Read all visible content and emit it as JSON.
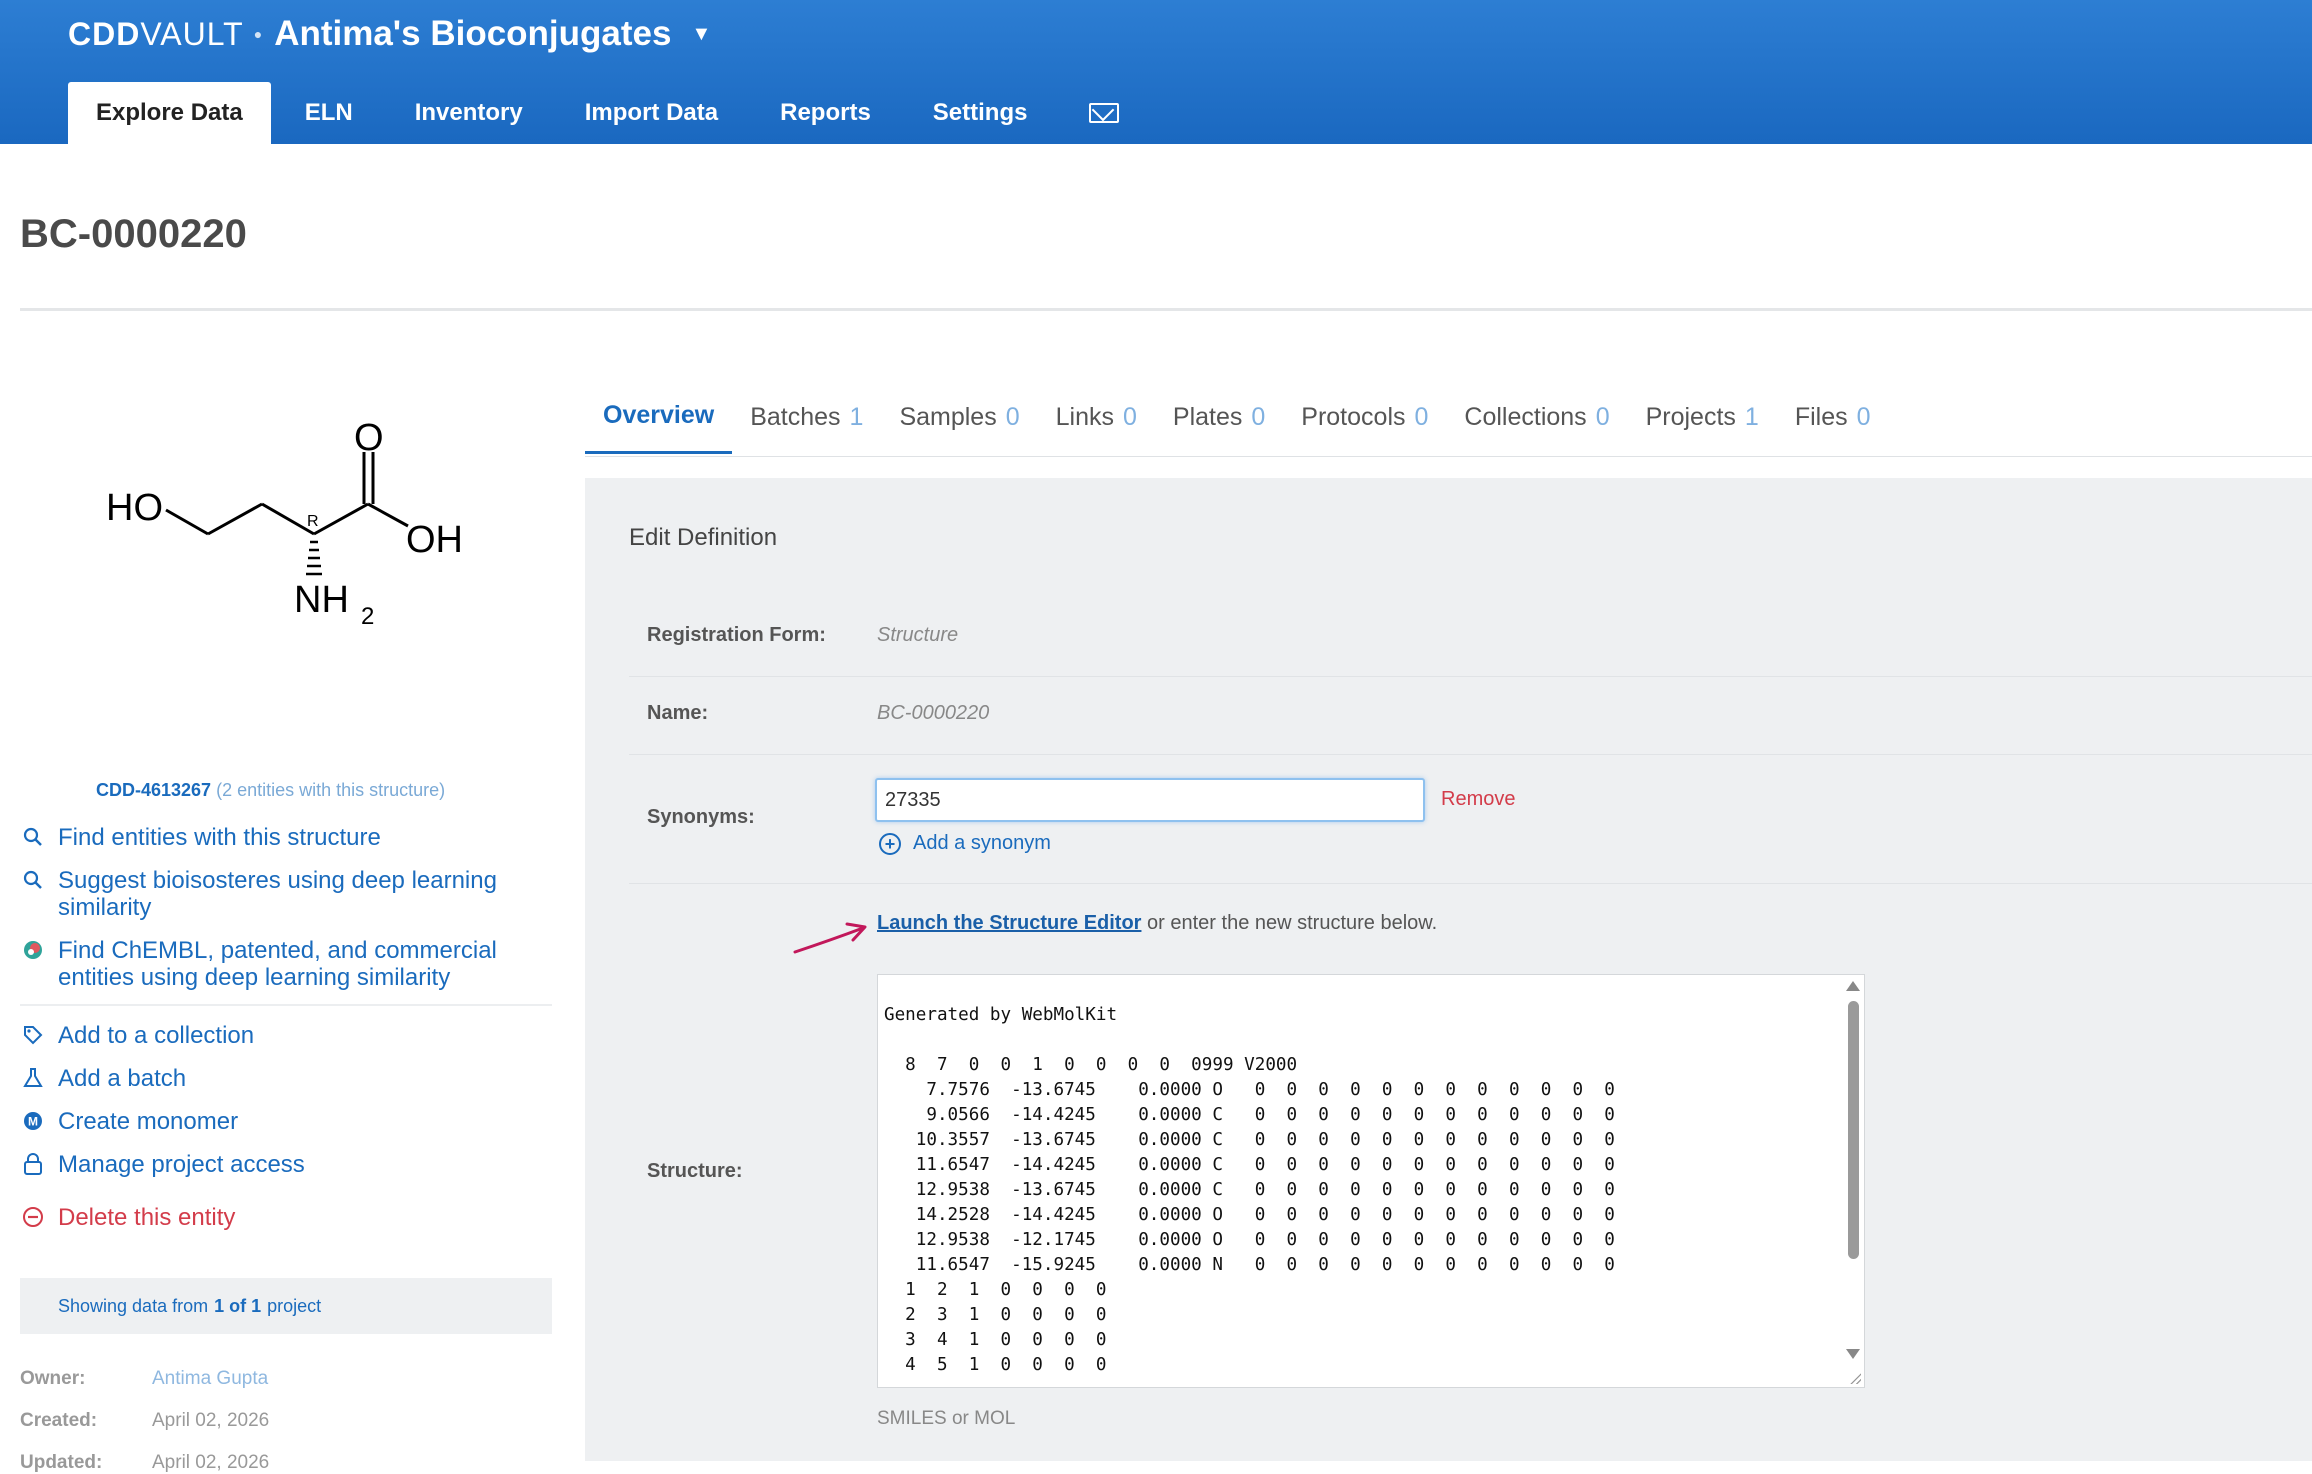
{
  "header": {
    "brand_bold": "CDD",
    "brand_light": "VAULT",
    "vault_name": "Antima's Bioconjugates",
    "nav": [
      {
        "label": "Explore Data",
        "active": true
      },
      {
        "label": "ELN"
      },
      {
        "label": "Inventory"
      },
      {
        "label": "Import Data"
      },
      {
        "label": "Reports"
      },
      {
        "label": "Settings"
      }
    ],
    "mail_icon": "envelope-icon"
  },
  "entity": {
    "title": "BC-0000220"
  },
  "structure_image": {
    "atoms": {
      "ho": "HO",
      "o": "O",
      "oh": "OH",
      "nh": "NH",
      "nh_sub": "2",
      "stereo": "R"
    }
  },
  "sidebar": {
    "reg_id": "CDD-4613267",
    "reg_note": "(2 entities with this structure)",
    "actions_top": [
      {
        "label": "Find entities with this structure",
        "icon": "search-icon"
      },
      {
        "label": "Suggest bioisosteres using deep learning similarity",
        "icon": "search-icon"
      },
      {
        "label": "Find ChEMBL, patented, and commercial entities using deep learning similarity",
        "icon": "chembl-icon"
      }
    ],
    "actions_bottom": [
      {
        "label": "Add to a collection",
        "icon": "tag-add-icon"
      },
      {
        "label": "Add a batch",
        "icon": "flask-icon"
      },
      {
        "label": "Create monomer",
        "icon": "monomer-icon"
      },
      {
        "label": "Manage project access",
        "icon": "lock-icon"
      }
    ],
    "delete_label": "Delete this entity",
    "showing": {
      "prefix": "Showing data from",
      "count": "1 of 1",
      "suffix": "project"
    },
    "meta": [
      {
        "key": "Owner:",
        "value": "Antima Gupta"
      },
      {
        "key": "Created:",
        "value": "April 02, 2026"
      },
      {
        "key": "Updated:",
        "value": "April 02, 2026"
      }
    ]
  },
  "tabs": [
    {
      "label": "Overview",
      "count": "",
      "active": true
    },
    {
      "label": "Batches",
      "count": "1"
    },
    {
      "label": "Samples",
      "count": "0"
    },
    {
      "label": "Links",
      "count": "0"
    },
    {
      "label": "Plates",
      "count": "0"
    },
    {
      "label": "Protocols",
      "count": "0"
    },
    {
      "label": "Collections",
      "count": "0"
    },
    {
      "label": "Projects",
      "count": "1"
    },
    {
      "label": "Files",
      "count": "0"
    }
  ],
  "form": {
    "heading": "Edit Definition",
    "registration_form_label": "Registration Form:",
    "registration_form_value": "Structure",
    "name_label": "Name:",
    "name_value": "BC-0000220",
    "synonyms_label": "Synonyms:",
    "synonym_value": "27335",
    "remove_label": "Remove",
    "add_synonym_label": "Add a synonym",
    "launch_link": "Launch the Structure Editor",
    "launch_suffix": " or enter the new structure below.",
    "structure_label": "Structure:",
    "molfile": "Generated by WebMolKit\n\n  8  7  0  0  1  0  0  0  0  0999 V2000\n    7.7576  -13.6745    0.0000 O   0  0  0  0  0  0  0  0  0  0  0  0\n    9.0566  -14.4245    0.0000 C   0  0  0  0  0  0  0  0  0  0  0  0\n   10.3557  -13.6745    0.0000 C   0  0  0  0  0  0  0  0  0  0  0  0\n   11.6547  -14.4245    0.0000 C   0  0  0  0  0  0  0  0  0  0  0  0\n   12.9538  -13.6745    0.0000 C   0  0  0  0  0  0  0  0  0  0  0  0\n   14.2528  -14.4245    0.0000 O   0  0  0  0  0  0  0  0  0  0  0  0\n   12.9538  -12.1745    0.0000 O   0  0  0  0  0  0  0  0  0  0  0  0\n   11.6547  -15.9245    0.0000 N   0  0  0  0  0  0  0  0  0  0  0  0\n  1  2  1  0  0  0  0\n  2  3  1  0  0  0  0\n  3  4  1  0  0  0  0\n  4  5  1  0  0  0  0",
    "structure_hint": "SMILES or MOL"
  },
  "colors": {
    "header_blue": "#1f6fc8",
    "link_blue": "#1a6bbd",
    "danger_red": "#d33c4a",
    "arrow_magenta": "#c2185b"
  }
}
